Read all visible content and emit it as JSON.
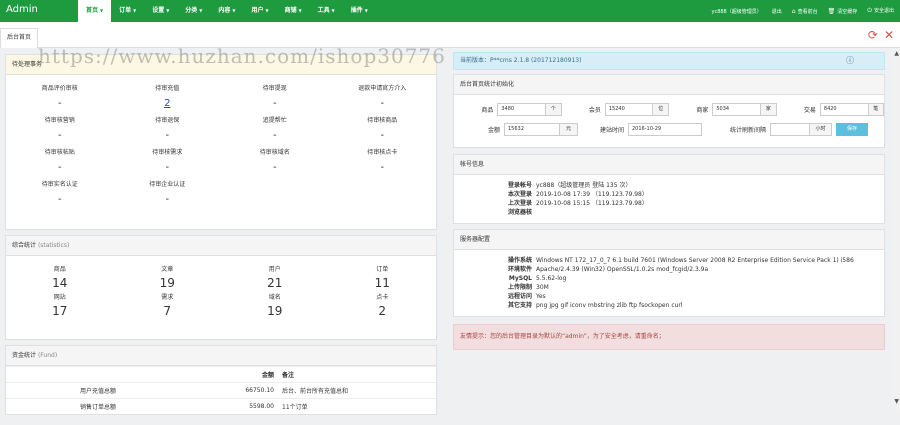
{
  "app": {
    "brand": "Admin",
    "nav": [
      {
        "label": "首页",
        "active": true
      },
      {
        "label": "订单",
        "active": false
      },
      {
        "label": "设置",
        "active": false
      },
      {
        "label": "分类",
        "active": false
      },
      {
        "label": "内容",
        "active": false
      },
      {
        "label": "用户",
        "active": false
      },
      {
        "label": "商铺",
        "active": false
      },
      {
        "label": "工具",
        "active": false
      },
      {
        "label": "插件",
        "active": false
      }
    ],
    "user": "yc888（超级管理员）",
    "logout": "退出",
    "links": [
      "查看前台",
      "清空缓存",
      "安全退出"
    ]
  },
  "tabs": {
    "home": "后台首页"
  },
  "watermark": "https://www.huzhan.com/ishop30776",
  "pending": {
    "title": "待处理事务",
    "items": [
      {
        "label": "商品评价审核",
        "value": "-"
      },
      {
        "label": "待审充值",
        "value": "2"
      },
      {
        "label": "待审提现",
        "value": "-"
      },
      {
        "label": "退款申请官方介入",
        "value": "-"
      },
      {
        "label": "待审核营销",
        "value": "-"
      },
      {
        "label": "待审退保",
        "value": "-"
      },
      {
        "label": "追提帮忙",
        "value": "-"
      },
      {
        "label": "待审核商品",
        "value": "-"
      },
      {
        "label": "待审核帖贴",
        "value": "-"
      },
      {
        "label": "待审核需求",
        "value": "-"
      },
      {
        "label": "待审核域名",
        "value": "-"
      },
      {
        "label": "待审核点卡",
        "value": "-"
      },
      {
        "label": "待审实名认证",
        "value": "-"
      },
      {
        "label": "待审企业认证",
        "value": "-"
      }
    ]
  },
  "stats": {
    "title": "综合统计",
    "subtitle": "(statistics)",
    "items": [
      {
        "label": "商品",
        "value": "14"
      },
      {
        "label": "文章",
        "value": "19"
      },
      {
        "label": "用户",
        "value": "21"
      },
      {
        "label": "订单",
        "value": "11"
      },
      {
        "label": "网站",
        "value": "17"
      },
      {
        "label": "需求",
        "value": "7"
      },
      {
        "label": "域名",
        "value": "19"
      },
      {
        "label": "点卡",
        "value": "2"
      }
    ]
  },
  "fund": {
    "title": "资金统计",
    "subtitle": "(Fund)",
    "headers": [
      "",
      "金额",
      "备注"
    ],
    "rows": [
      [
        "用户充值总额",
        "66750.10",
        "后台、前台所有充值总和"
      ],
      [
        "销售订单总额",
        "5598.00",
        "11个订单"
      ]
    ]
  },
  "version": {
    "text": "当前版本：P**cms 2.1.8 (201712180913)"
  },
  "init": {
    "title": "后台首页统计初始化",
    "fields": [
      {
        "label": "商品",
        "value": "3480",
        "addon": "个"
      },
      {
        "label": "会员",
        "value": "15240",
        "addon": "位"
      },
      {
        "label": "商家",
        "value": "5034",
        "addon": "家"
      },
      {
        "label": "交易",
        "value": "8420",
        "addon": "笔"
      },
      {
        "label": "金额",
        "value": "15632",
        "addon": "元"
      },
      {
        "label": "建站时间",
        "value": "2016-10-29",
        "addon": ""
      },
      {
        "label": "统计刷新间隔",
        "value": "",
        "addon": "小时"
      }
    ],
    "save": "保存"
  },
  "account": {
    "title": "帐号信息",
    "rows": [
      {
        "k": "登录帐号",
        "v": "yc888（超级管理员 登陆 135 次）"
      },
      {
        "k": "本次登录",
        "v": "2019-10-08 17:39 （119.123.79.98）"
      },
      {
        "k": "上次登录",
        "v": "2019-10-08 15:15 （119.123.79.98）"
      },
      {
        "k": "浏览器核",
        "v": ""
      }
    ]
  },
  "server": {
    "title": "服务器配置",
    "rows": [
      {
        "k": "操作系统",
        "v": "Windows NT 172_17_0_7 6.1 build 7601 (Windows Server 2008 R2 Enterprise Edition Service Pack 1) i586"
      },
      {
        "k": "环境软件",
        "v": "Apache/2.4.39 (Win32) OpenSSL/1.0.2s mod_fcgid/2.3.9a"
      },
      {
        "k": "MySQL",
        "v": "5.5.62-log"
      },
      {
        "k": "上传限制",
        "v": "30M"
      },
      {
        "k": "远程访问",
        "v": "Yes"
      },
      {
        "k": "其它支持",
        "v": "png jpg gif iconv mbstring zlib ftp fsockopen curl"
      }
    ]
  },
  "alert": {
    "text": "友情提示：您的后台管理目录为默认的“admin”，为了安全考虑，请重命名；"
  }
}
